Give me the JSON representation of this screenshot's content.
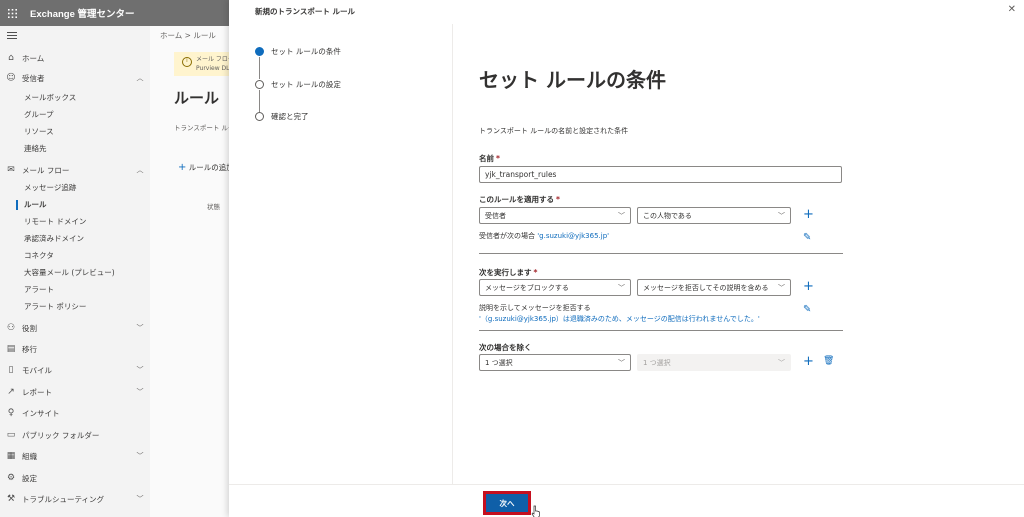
{
  "app": {
    "title": "Exchange 管理センター"
  },
  "nav": {
    "items": [
      {
        "label": "ホーム",
        "icon": "home-icon"
      },
      {
        "label": "受信者",
        "icon": "person-icon",
        "expanded": true,
        "children": [
          "メールボックス",
          "グループ",
          "リソース",
          "連絡先"
        ]
      },
      {
        "label": "メール フロー",
        "icon": "mail-icon",
        "expanded": true,
        "children": [
          "メッセージ追跡",
          "ルール",
          "リモート ドメイン",
          "承認済みドメイン",
          "コネクタ",
          "大容量メール (プレビュー)",
          "アラート",
          "アラート ポリシー"
        ]
      },
      {
        "label": "役割",
        "icon": "roles-icon",
        "expanded": false
      },
      {
        "label": "移行",
        "icon": "migration-icon"
      },
      {
        "label": "モバイル",
        "icon": "mobile-icon",
        "expanded": false
      },
      {
        "label": "レポート",
        "icon": "chart-icon",
        "expanded": false
      },
      {
        "label": "インサイト",
        "icon": "bulb-icon"
      },
      {
        "label": "パブリック フォルダー",
        "icon": "folder-icon"
      },
      {
        "label": "組織",
        "icon": "org-icon",
        "expanded": false
      },
      {
        "label": "設定",
        "icon": "gear-icon"
      },
      {
        "label": "トラブルシューティング",
        "icon": "wrench-icon",
        "expanded": false
      }
    ],
    "active_item": "ルール"
  },
  "background_page": {
    "breadcrumb": "ホーム  >  ルール",
    "banner_line1": "メール フロー ルー",
    "banner_line2": "Purview DLP",
    "title": "ルール",
    "description": "トランスポート ルー",
    "add_rule": "ルールの追加",
    "column_status": "状態"
  },
  "panel": {
    "title": "新規のトランスポート ルール",
    "close_glyph": "✕",
    "steps": [
      {
        "label": "セット ルールの条件",
        "active": true
      },
      {
        "label": "セット ルールの設定",
        "active": false
      },
      {
        "label": "確認と完了",
        "active": false
      }
    ],
    "heading": "セット ルールの条件",
    "description": "トランスポート ルールの名前と設定された条件",
    "name_label": "名前",
    "name_value": "yjk_transport_rules",
    "apply_label": "このルールを適用する",
    "apply_dd1": "受信者",
    "apply_dd2": "この人物である",
    "apply_note_prefix": "受信者が次の場合 ",
    "apply_note_link": "'g.suzuki@yjk365.jp'",
    "do_label": "次を実行します",
    "do_dd1": "メッセージをブロックする",
    "do_dd2": "メッセージを拒否してその説明を含める",
    "do_note": "説明を示してメッセージを拒否する",
    "do_note_link": "'（g.suzuki@yjk365.jp）は退職済みのため、メッセージの配信は行われませんでした。'",
    "except_label": "次の場合を除く",
    "except_dd1": "1 つ選択",
    "except_dd2": "1 つ選択",
    "required_mark": "*",
    "next_button": "次へ"
  }
}
